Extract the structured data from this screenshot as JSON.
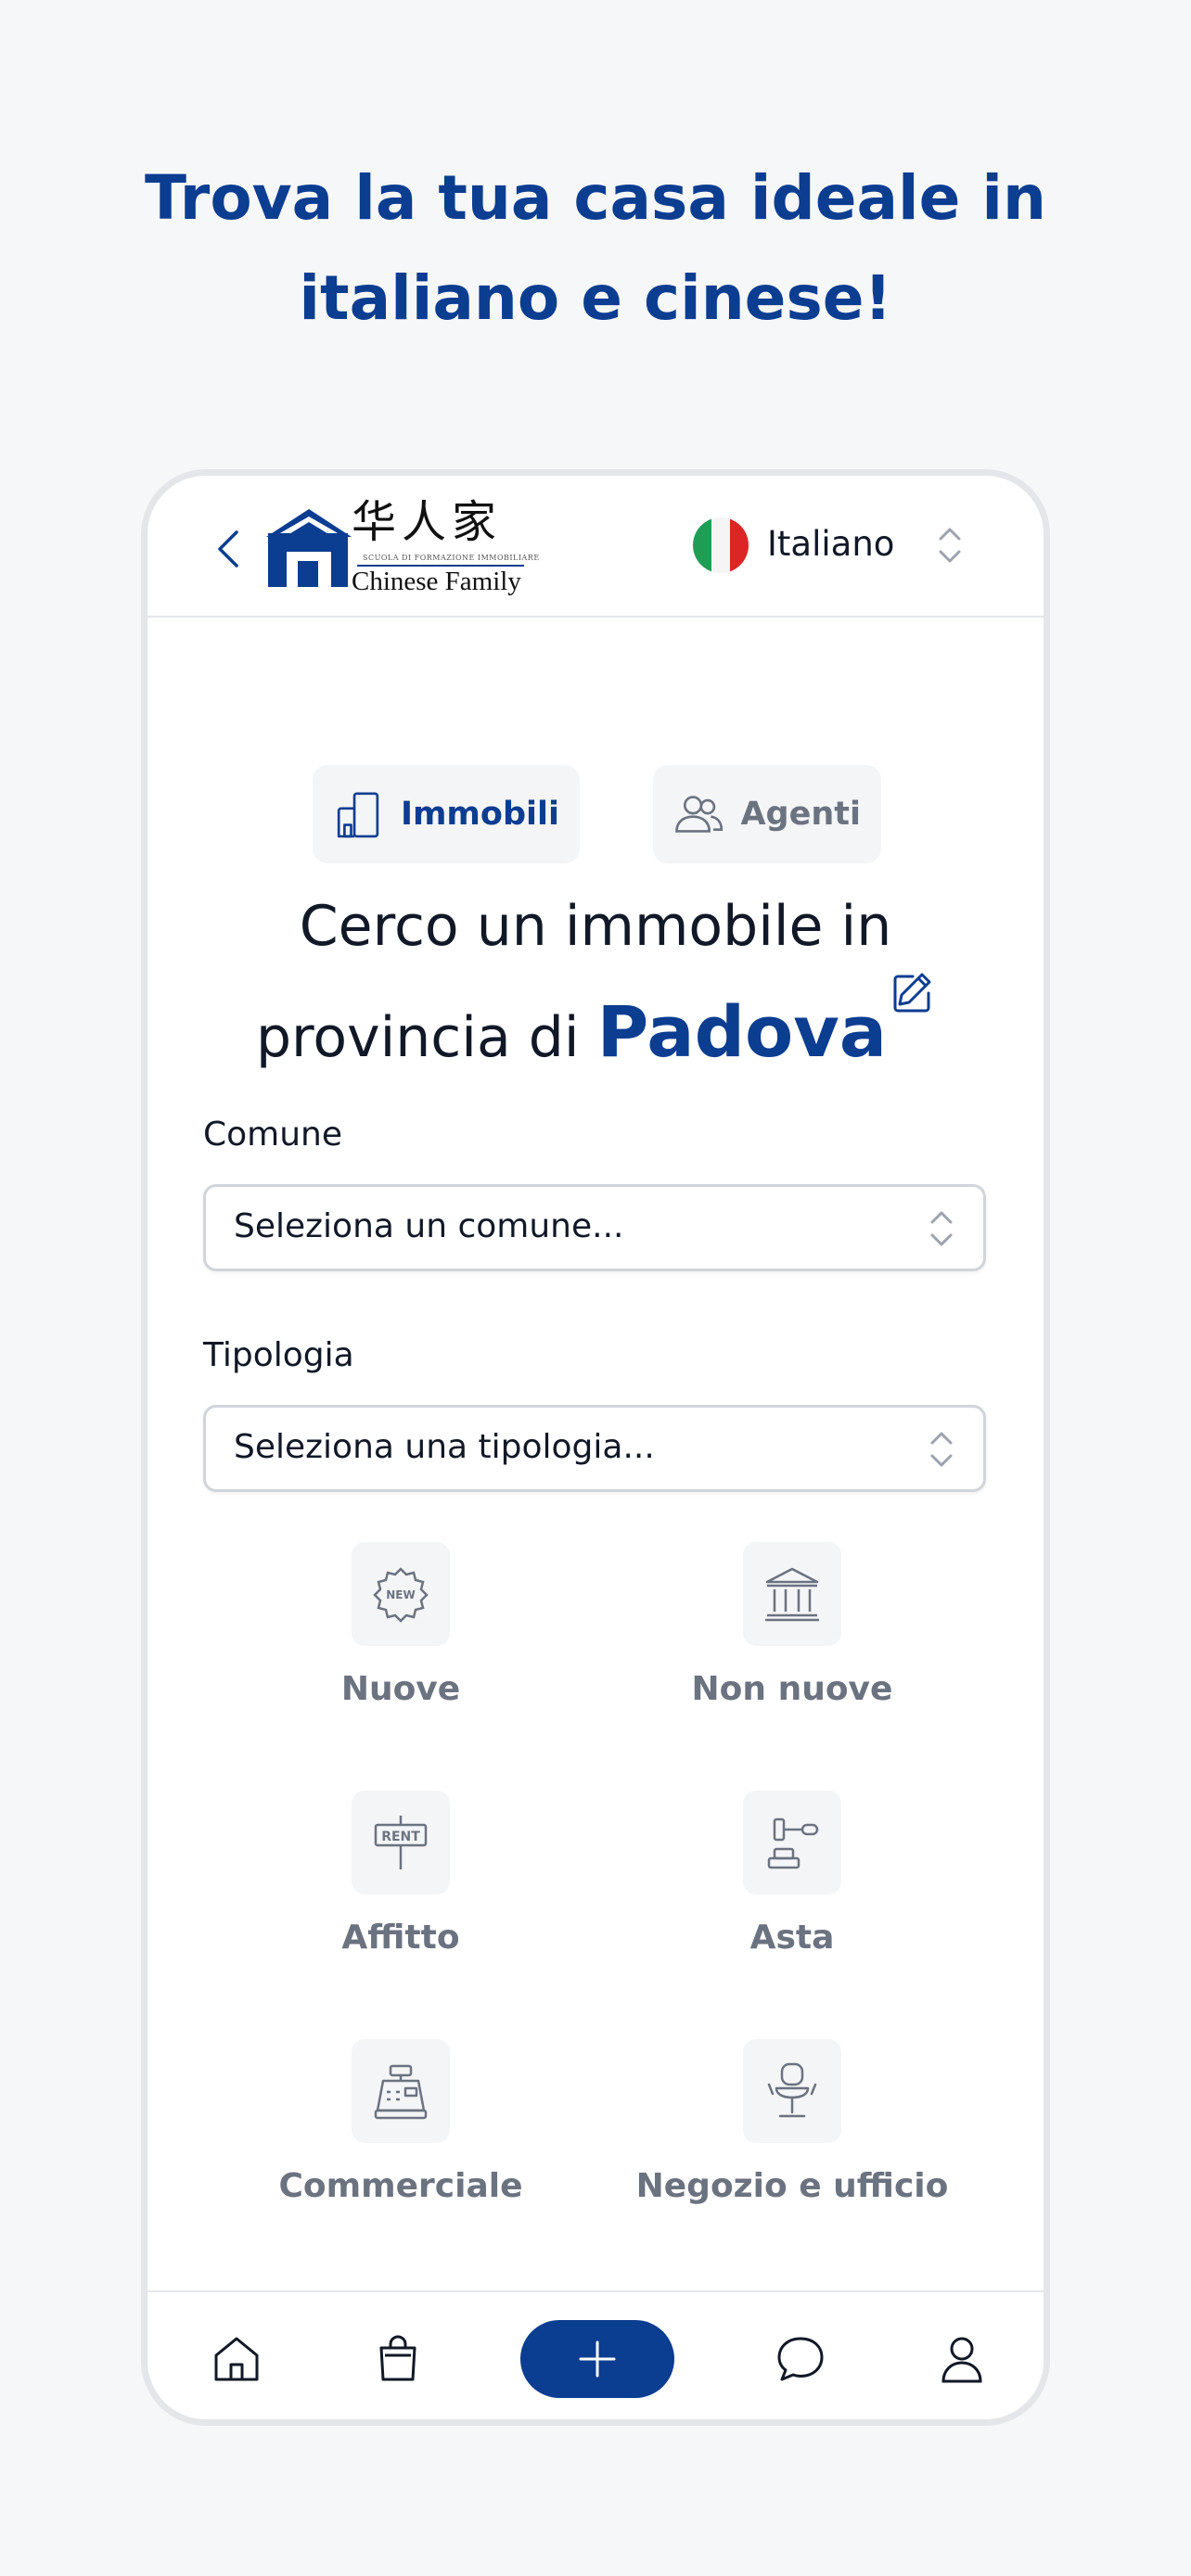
{
  "headline": {
    "line1": "Trova la tua casa ideale in",
    "line2": "italiano e cinese!"
  },
  "colors": {
    "brand": "#0b3d91",
    "muted": "#6b7280",
    "text": "#111827",
    "chip_bg": "#f4f5f7"
  },
  "header": {
    "back_icon": "chevron-left-icon",
    "logo": {
      "chinese": "华人家",
      "subtitle": "SCUOLA DI FORMAZIONE IMMOBILIARE",
      "english": "Chinese Family"
    },
    "language": {
      "flag": "italy-flag-icon",
      "label": "Italiano"
    }
  },
  "tabs": [
    {
      "label": "Immobili",
      "icon": "building-icon",
      "active": true
    },
    {
      "label": "Agenti",
      "icon": "users-icon",
      "active": false
    }
  ],
  "search": {
    "prefix_line1": "Cerco un immobile in",
    "prefix_line2": "provincia di",
    "province": "Padova"
  },
  "comune": {
    "label": "Comune",
    "placeholder": "Seleziona un comune..."
  },
  "tipologia": {
    "label": "Tipologia",
    "placeholder": "Seleziona una tipologia..."
  },
  "categories": [
    {
      "label": "Nuove",
      "icon": "new-badge-icon"
    },
    {
      "label": "Non nuove",
      "icon": "classical-building-icon"
    },
    {
      "label": "Affitto",
      "icon": "rent-sign-icon"
    },
    {
      "label": "Asta",
      "icon": "gavel-icon"
    },
    {
      "label": "Commerciale",
      "icon": "cash-register-icon"
    },
    {
      "label": "Negozio e ufficio",
      "icon": "office-chair-icon"
    }
  ],
  "bottom_nav": [
    {
      "icon": "home-icon"
    },
    {
      "icon": "shopping-bag-icon"
    },
    {
      "icon": "plus-icon"
    },
    {
      "icon": "chat-icon"
    },
    {
      "icon": "user-icon"
    }
  ]
}
